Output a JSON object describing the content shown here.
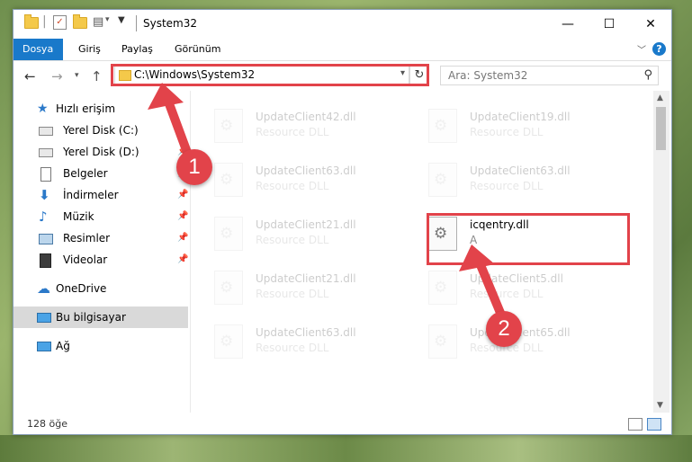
{
  "window": {
    "title": "System32",
    "controls": {
      "minimize": "—",
      "maximize": "☐",
      "close": "✕"
    }
  },
  "ribbon": {
    "tabs": [
      {
        "label": "Dosya",
        "active": true
      },
      {
        "label": "Giriş",
        "active": false
      },
      {
        "label": "Paylaş",
        "active": false
      },
      {
        "label": "Görünüm",
        "active": false
      }
    ],
    "help": "?"
  },
  "address": {
    "path": "C:\\Windows\\System32",
    "refresh": "↻",
    "search_placeholder": "Ara: System32"
  },
  "sidebar": {
    "items": [
      {
        "label": "Hızlı erişim",
        "icon": "star-icon",
        "pinned": false
      },
      {
        "label": "Yerel Disk (C:)",
        "icon": "drive-icon",
        "pinned": false
      },
      {
        "label": "Yerel Disk (D:)",
        "icon": "drive-icon",
        "pinned": true
      },
      {
        "label": "Belgeler",
        "icon": "documents-icon",
        "pinned": true
      },
      {
        "label": "İndirmeler",
        "icon": "download-icon",
        "pinned": true
      },
      {
        "label": "Müzik",
        "icon": "music-icon",
        "pinned": true
      },
      {
        "label": "Resimler",
        "icon": "pictures-icon",
        "pinned": true
      },
      {
        "label": "Videolar",
        "icon": "video-icon",
        "pinned": true
      },
      {
        "label": "OneDrive",
        "icon": "cloud-icon",
        "pinned": false
      },
      {
        "label": "Bu bilgisayar",
        "icon": "computer-icon",
        "pinned": false,
        "selected": true
      },
      {
        "label": "Ağ",
        "icon": "network-icon",
        "pinned": false
      }
    ]
  },
  "files": [
    {
      "name": "UpdateClient42.dll",
      "type": "Resource DLL"
    },
    {
      "name": "UpdateClient19.dll",
      "type": "Resource DLL"
    },
    {
      "name": "UpdateClient63.dll",
      "type": "Resource DLL"
    },
    {
      "name": "UpdateClient63.dll",
      "type": "Resource DLL"
    },
    {
      "name": "UpdateClient21.dll",
      "type": "Resource DLL"
    },
    {
      "name": "icqentry.dll",
      "type": "A"
    },
    {
      "name": "UpdateClient21.dll",
      "type": "Resource DLL"
    },
    {
      "name": "UpdateClient5.dll",
      "type": "Resource DLL"
    },
    {
      "name": "UpdateClient63.dll",
      "type": "Resource DLL"
    },
    {
      "name": "UpdateClient65.dll",
      "type": "Resource DLL"
    }
  ],
  "status": {
    "item_count": "128 öğe"
  },
  "callouts": {
    "one": "1",
    "two": "2"
  },
  "colors": {
    "accent": "#1979ca",
    "highlight": "#e2434a",
    "folder": "#f4c94a"
  }
}
